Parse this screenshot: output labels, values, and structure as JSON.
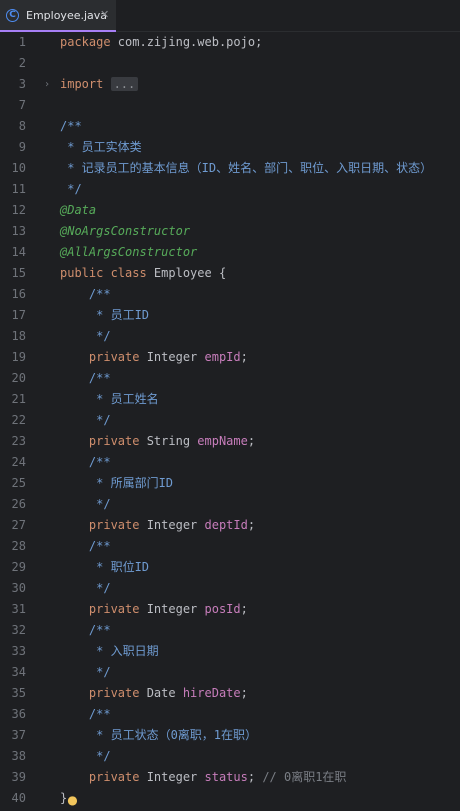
{
  "tab": {
    "icon": "class-file-icon",
    "icon_glyph": "C",
    "title": "Employee.java",
    "close": "✕"
  },
  "lines": [
    {
      "n": "1",
      "t": [
        [
          "kw",
          "package "
        ],
        [
          "pkg",
          "com.zijing.web.pojo;"
        ]
      ]
    },
    {
      "n": "2",
      "t": []
    },
    {
      "n": "3",
      "fold": true,
      "t": [
        [
          "kw",
          "import "
        ],
        [
          "dots",
          "..."
        ]
      ]
    },
    {
      "n": "7",
      "t": []
    },
    {
      "n": "8",
      "t": [
        [
          "javadoc",
          "/**"
        ]
      ]
    },
    {
      "n": "9",
      "t": [
        [
          "javadoc",
          " * 员工实体类"
        ]
      ]
    },
    {
      "n": "10",
      "t": [
        [
          "javadoc",
          " * 记录员工的基本信息（ID、姓名、部门、职位、入职日期、状态）"
        ]
      ]
    },
    {
      "n": "11",
      "t": [
        [
          "javadoc",
          " */"
        ]
      ]
    },
    {
      "n": "12",
      "t": [
        [
          "an2",
          "@Data"
        ]
      ]
    },
    {
      "n": "13",
      "t": [
        [
          "an2",
          "@NoArgsConstructor"
        ]
      ]
    },
    {
      "n": "14",
      "t": [
        [
          "an2",
          "@AllArgsConstructor"
        ]
      ]
    },
    {
      "n": "15",
      "t": [
        [
          "kw",
          "public class "
        ],
        [
          "cls",
          "Employee "
        ],
        [
          "brace",
          "{"
        ]
      ]
    },
    {
      "n": "16",
      "t": [
        [
          "javadoc",
          "    /**"
        ]
      ]
    },
    {
      "n": "17",
      "t": [
        [
          "javadoc",
          "     * 员工ID"
        ]
      ]
    },
    {
      "n": "18",
      "t": [
        [
          "javadoc",
          "     */"
        ]
      ]
    },
    {
      "n": "19",
      "t": [
        [
          "kw",
          "    private "
        ],
        [
          "type",
          "Integer "
        ],
        [
          "fld",
          "empId"
        ],
        [
          "type",
          ";"
        ]
      ]
    },
    {
      "n": "20",
      "t": [
        [
          "javadoc",
          "    /**"
        ]
      ]
    },
    {
      "n": "21",
      "t": [
        [
          "javadoc",
          "     * 员工姓名"
        ]
      ]
    },
    {
      "n": "22",
      "t": [
        [
          "javadoc",
          "     */"
        ]
      ]
    },
    {
      "n": "23",
      "t": [
        [
          "kw",
          "    private "
        ],
        [
          "type",
          "String "
        ],
        [
          "fld",
          "empName"
        ],
        [
          "type",
          ";"
        ]
      ]
    },
    {
      "n": "24",
      "t": [
        [
          "javadoc",
          "    /**"
        ]
      ]
    },
    {
      "n": "25",
      "t": [
        [
          "javadoc",
          "     * 所属部门ID"
        ]
      ]
    },
    {
      "n": "26",
      "t": [
        [
          "javadoc",
          "     */"
        ]
      ]
    },
    {
      "n": "27",
      "t": [
        [
          "kw",
          "    private "
        ],
        [
          "type",
          "Integer "
        ],
        [
          "fld",
          "deptId"
        ],
        [
          "type",
          ";"
        ]
      ]
    },
    {
      "n": "28",
      "t": [
        [
          "javadoc",
          "    /**"
        ]
      ]
    },
    {
      "n": "29",
      "t": [
        [
          "javadoc",
          "     * 职位ID"
        ]
      ]
    },
    {
      "n": "30",
      "t": [
        [
          "javadoc",
          "     */"
        ]
      ]
    },
    {
      "n": "31",
      "t": [
        [
          "kw",
          "    private "
        ],
        [
          "type",
          "Integer "
        ],
        [
          "fld",
          "posId"
        ],
        [
          "type",
          ";"
        ]
      ]
    },
    {
      "n": "32",
      "t": [
        [
          "javadoc",
          "    /**"
        ]
      ]
    },
    {
      "n": "33",
      "t": [
        [
          "javadoc",
          "     * 入职日期"
        ]
      ]
    },
    {
      "n": "34",
      "t": [
        [
          "javadoc",
          "     */"
        ]
      ]
    },
    {
      "n": "35",
      "t": [
        [
          "kw",
          "    private "
        ],
        [
          "type",
          "Date "
        ],
        [
          "fld",
          "hireDate"
        ],
        [
          "type",
          ";"
        ]
      ]
    },
    {
      "n": "36",
      "t": [
        [
          "javadoc",
          "    /**"
        ]
      ]
    },
    {
      "n": "37",
      "t": [
        [
          "javadoc",
          "     * 员工状态（0离职，1在职）"
        ]
      ]
    },
    {
      "n": "38",
      "t": [
        [
          "javadoc",
          "     */"
        ]
      ]
    },
    {
      "n": "39",
      "t": [
        [
          "kw",
          "    private "
        ],
        [
          "type",
          "Integer "
        ],
        [
          "fld",
          "status"
        ],
        [
          "type",
          "; "
        ],
        [
          "cm",
          "// 0离职1在职"
        ]
      ]
    },
    {
      "n": "40",
      "t": [
        [
          "brace",
          "}"
        ]
      ],
      "bulb": true
    }
  ],
  "colors": {
    "background": "#1e1f22",
    "keyword": "#cf8e6d",
    "field": "#c77dbb",
    "annotation": "#57ab5a",
    "javadoc": "#6f9bd1",
    "tab_accent": "#a77ff5"
  }
}
